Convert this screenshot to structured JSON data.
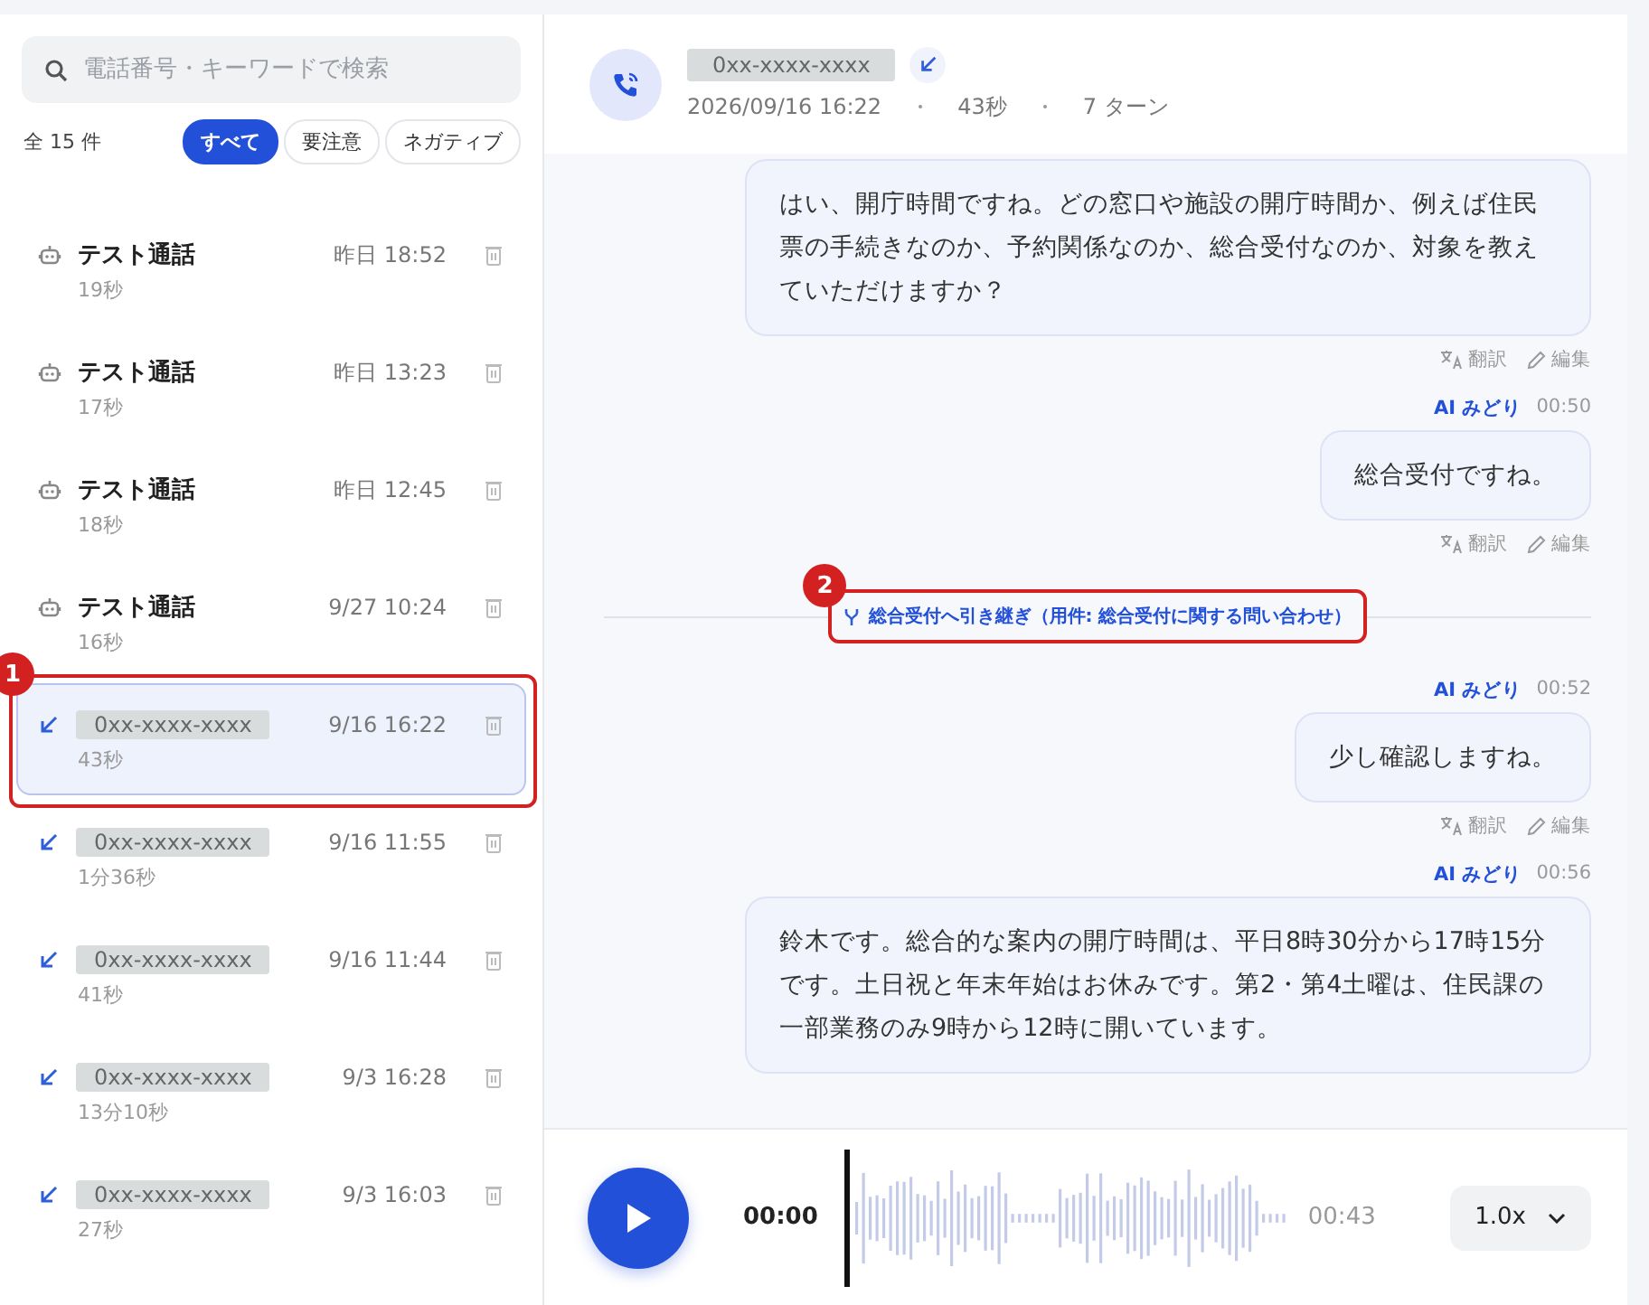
{
  "sidebar": {
    "search": {
      "placeholder": "電話番号・キーワードで検索"
    },
    "count": "全 15 件",
    "filters": [
      {
        "label": "すべて",
        "selected": true
      },
      {
        "label": "要注意",
        "selected": false
      },
      {
        "label": "ネガティブ",
        "selected": false
      }
    ],
    "items": [
      {
        "kind": "test",
        "title": "テスト通話",
        "time": "昨日 18:52",
        "duration": "19秒",
        "selected": false
      },
      {
        "kind": "test",
        "title": "テスト通話",
        "time": "昨日 13:23",
        "duration": "17秒",
        "selected": false
      },
      {
        "kind": "test",
        "title": "テスト通話",
        "time": "昨日 12:45",
        "duration": "18秒",
        "selected": false
      },
      {
        "kind": "test",
        "title": "テスト通話",
        "time": "9/27 10:24",
        "duration": "16秒",
        "selected": false
      },
      {
        "kind": "incoming",
        "title": "0xx-xxxx-xxxx",
        "time": "9/16 16:22",
        "duration": "43秒",
        "selected": true,
        "callout": "1"
      },
      {
        "kind": "incoming",
        "title": "0xx-xxxx-xxxx",
        "time": "9/16 11:55",
        "duration": "1分36秒",
        "selected": false
      },
      {
        "kind": "incoming",
        "title": "0xx-xxxx-xxxx",
        "time": "9/16 11:44",
        "duration": "41秒",
        "selected": false
      },
      {
        "kind": "incoming",
        "title": "0xx-xxxx-xxxx",
        "time": "9/3 16:28",
        "duration": "13分10秒",
        "selected": false
      },
      {
        "kind": "incoming",
        "title": "0xx-xxxx-xxxx",
        "time": "9/3 16:03",
        "duration": "27秒",
        "selected": false
      }
    ]
  },
  "header": {
    "number": "0xx-xxxx-xxxx",
    "datetime": "2026/09/16 16:22",
    "duration": "43秒",
    "turns": "7 ターン"
  },
  "messages": [
    {
      "kind": "ai",
      "text": "はい、開庁時間ですね。どの窓口や施設の開庁時間か、例えば住民票の手続きなのか、予約関係なのか、総合受付なのか、対象を教えていただけますか？",
      "actions": [
        "翻訳",
        "編集"
      ]
    },
    {
      "kind": "ai",
      "speaker": "AI みどり",
      "time": "00:50",
      "text": "総合受付ですね。",
      "actions": [
        "翻訳",
        "編集"
      ]
    },
    {
      "kind": "handoff",
      "text": "総合受付へ引き継ぎ（用件: 総合受付に関する問い合わせ）",
      "callout": "2"
    },
    {
      "kind": "ai",
      "speaker": "AI みどり",
      "time": "00:52",
      "text": "少し確認しますね。",
      "actions": [
        "翻訳",
        "編集"
      ]
    },
    {
      "kind": "ai",
      "speaker": "AI みどり",
      "time": "00:56",
      "text": "鈴木です。総合的な案内の開庁時間は、平日8時30分から17時15分です。土日祝と年末年始はお休みです。第2・第4土曜は、住民課の一部業務のみ9時から12時に開いています。"
    }
  ],
  "player": {
    "current": "00:00",
    "total": "00:43",
    "speed": "1.0x"
  }
}
